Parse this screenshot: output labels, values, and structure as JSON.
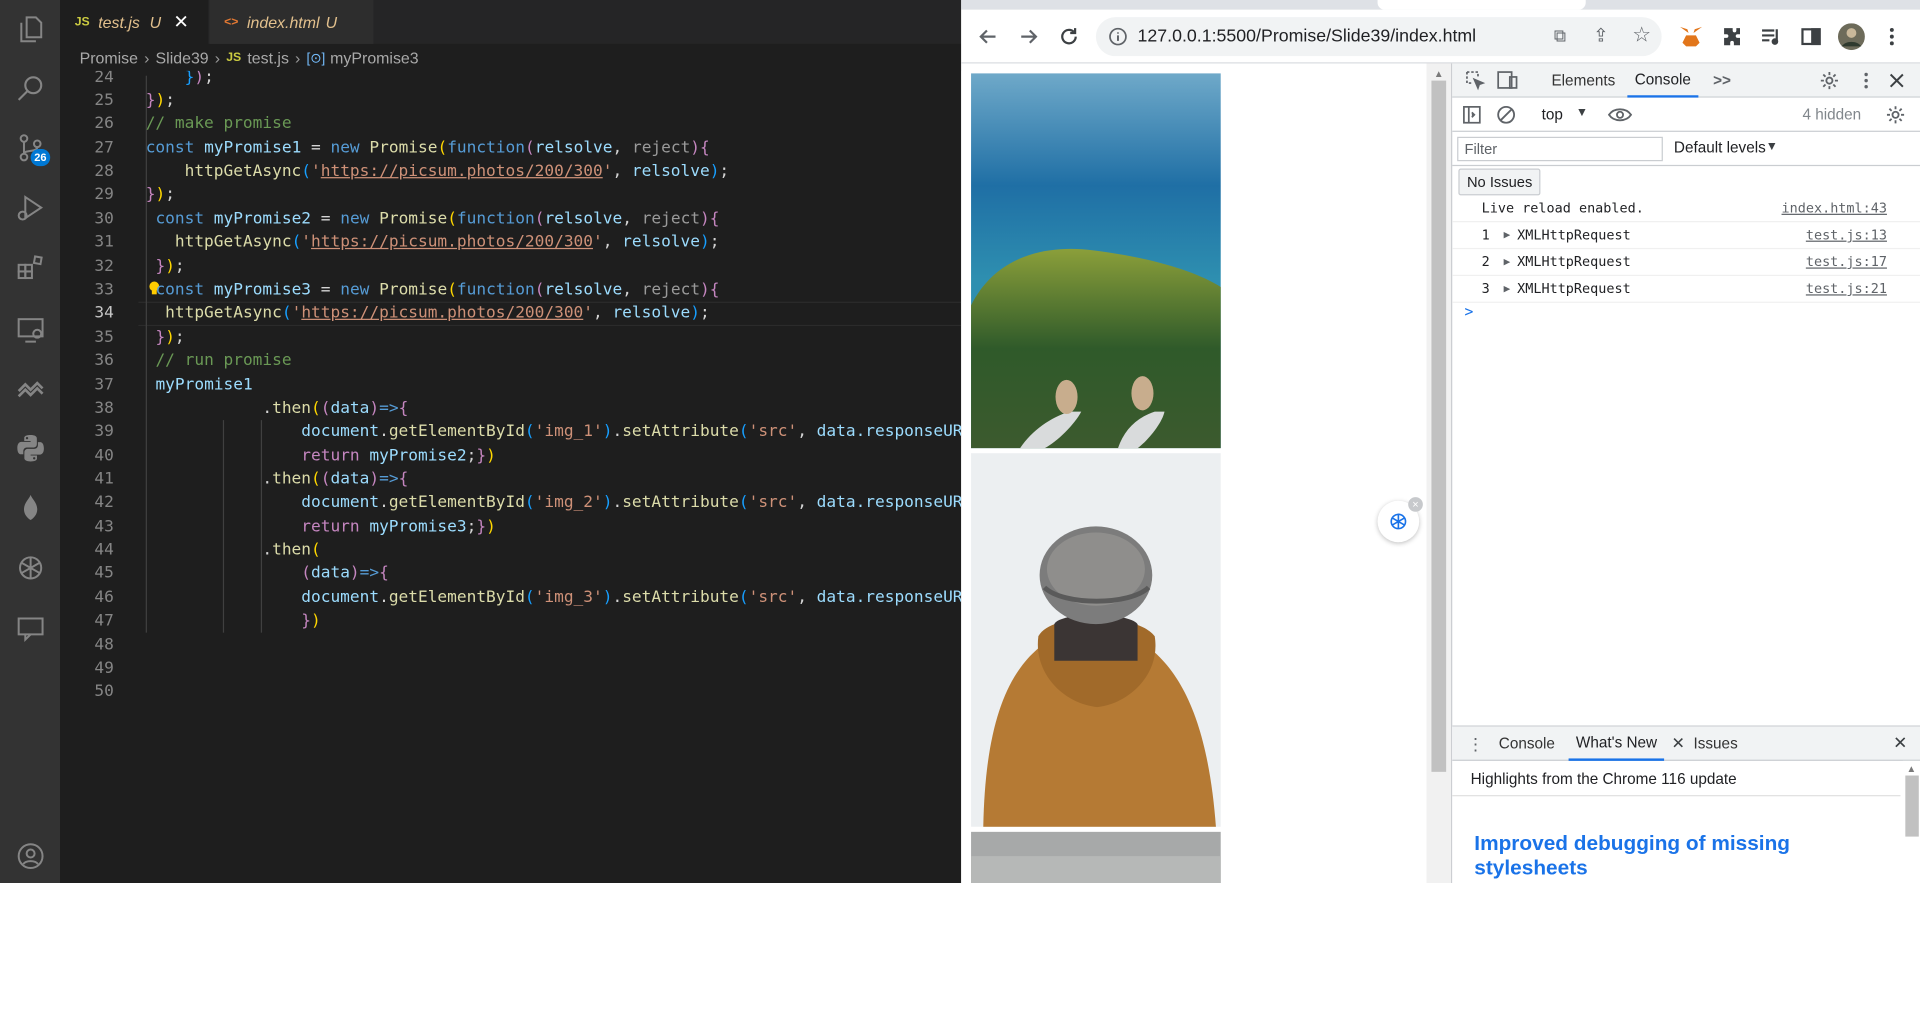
{
  "editor": {
    "tabs": [
      {
        "icon": "JS",
        "name": "test.js",
        "status": "U"
      },
      {
        "icon": "<>",
        "name": "index.html",
        "status": "U"
      }
    ],
    "breadcrumb": [
      "Promise",
      "Slide39",
      "test.js",
      "myPromise3"
    ],
    "activity_badge": "26",
    "line_numbers": [
      "24",
      "25",
      "26",
      "27",
      "28",
      "29",
      "30",
      "31",
      "32",
      "33",
      "34",
      "35",
      "36",
      "37",
      "38",
      "39",
      "40",
      "41",
      "42",
      "43",
      "44",
      "45",
      "46",
      "47",
      "48",
      "49",
      "50"
    ],
    "current_line": "34",
    "code": {
      "l29_url": "https://picsum.photos/200/300",
      "l31_url": "https://picsum.photos/200/300",
      "l33_url": "https://picsum.photos/200/300",
      "comment_make": "// make promise",
      "comment_run": "// run promise",
      "img1": "'img_1'",
      "img2": "'img_2'",
      "img3": "'img_3'",
      "src": "'src'",
      "response_trunc": "data.responseURL"
    }
  },
  "browser": {
    "url": "127.0.0.1:5500/Promise/Slide39/index.html",
    "accent": "#1a73e8"
  },
  "devtools": {
    "tabs": [
      "Elements",
      "Console"
    ],
    "more": ">>",
    "context": "top",
    "hidden": "4 hidden",
    "filter_placeholder": "Filter",
    "levels": "Default levels",
    "no_issues": "No Issues",
    "logs": [
      {
        "num": "",
        "text": "Live reload enabled.",
        "src": "index.html:43"
      },
      {
        "num": "1",
        "text": "XMLHttpRequest",
        "src": "test.js:13"
      },
      {
        "num": "2",
        "text": "XMLHttpRequest",
        "src": "test.js:17"
      },
      {
        "num": "3",
        "text": "XMLHttpRequest",
        "src": "test.js:21"
      }
    ],
    "prompt": ">",
    "drawer_tabs": [
      "Console",
      "What's New",
      "Issues"
    ],
    "highlights": "Highlights from the Chrome 116 update",
    "headline": "Improved debugging of missing stylesheets"
  }
}
